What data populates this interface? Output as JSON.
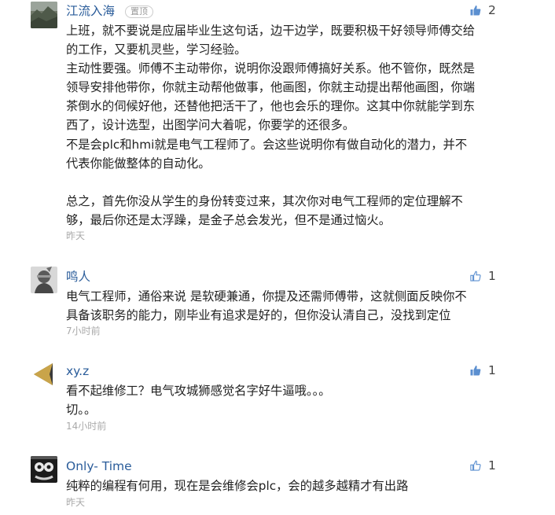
{
  "comments": [
    {
      "author": "江流入海",
      "badge": "置顶",
      "likes": "2",
      "like_icon": "thumbs-up-filled",
      "lines": [
        "上班，就不要说是应届毕业生这句话，边干边学，既要积极干好领导师傅交给",
        "的工作，又要机灵些，学习经验。",
        "主动性要强。师傅不主动带你，说明你没跟师傅搞好关系。他不管你，既然是",
        "领导安排他带你，你就主动帮他做事，他画图，你就主动提出帮他画图，你端",
        "茶倒水的伺候好他，还替他把活干了，他也会乐的理你。这其中你就能学到东",
        "西了，设计选型，出图学问大着呢，你要学的还很多。",
        "不是会plc和hmi就是电气工程师了。会这些说明你有做自动化的潜力，并不",
        "代表你能做整体的自动化。",
        "",
        "总之，首先你没从学生的身份转变过来，其次你对电气工程师的定位理解不",
        "够，最后你还是太浮躁，是金子总会发光，但不是通过恼火。"
      ],
      "time": "昨天"
    },
    {
      "author": "鸣人",
      "likes": "1",
      "like_icon": "thumbs-up-outline",
      "lines": [
        "电气工程师，通俗来说 是软硬兼通，你提及还需师傅带，这就侧面反映你不",
        "具备该职务的能力，刚毕业有追求是好的，但你没认清自己，没找到定位"
      ],
      "time": "7小时前"
    },
    {
      "author": "xy.z",
      "likes": "1",
      "like_icon": "thumbs-up-filled",
      "lines": [
        "看不起维修工？电气攻城狮感觉名字好牛逼哦。。。",
        "切。。"
      ],
      "time": "14小时前"
    },
    {
      "author": "Only- Time",
      "likes": "1",
      "like_icon": "thumbs-up-outline",
      "lines": [
        "纯粹的编程有何用，现在是会维修会plc，会的越多越精才有出路"
      ],
      "time": "昨天"
    }
  ],
  "colors": {
    "author": "#2a5c9a",
    "text": "#222222",
    "time": "#aaaaaa",
    "like_filled": "#5b8fd0",
    "like_outline": "#5b8fd0"
  }
}
